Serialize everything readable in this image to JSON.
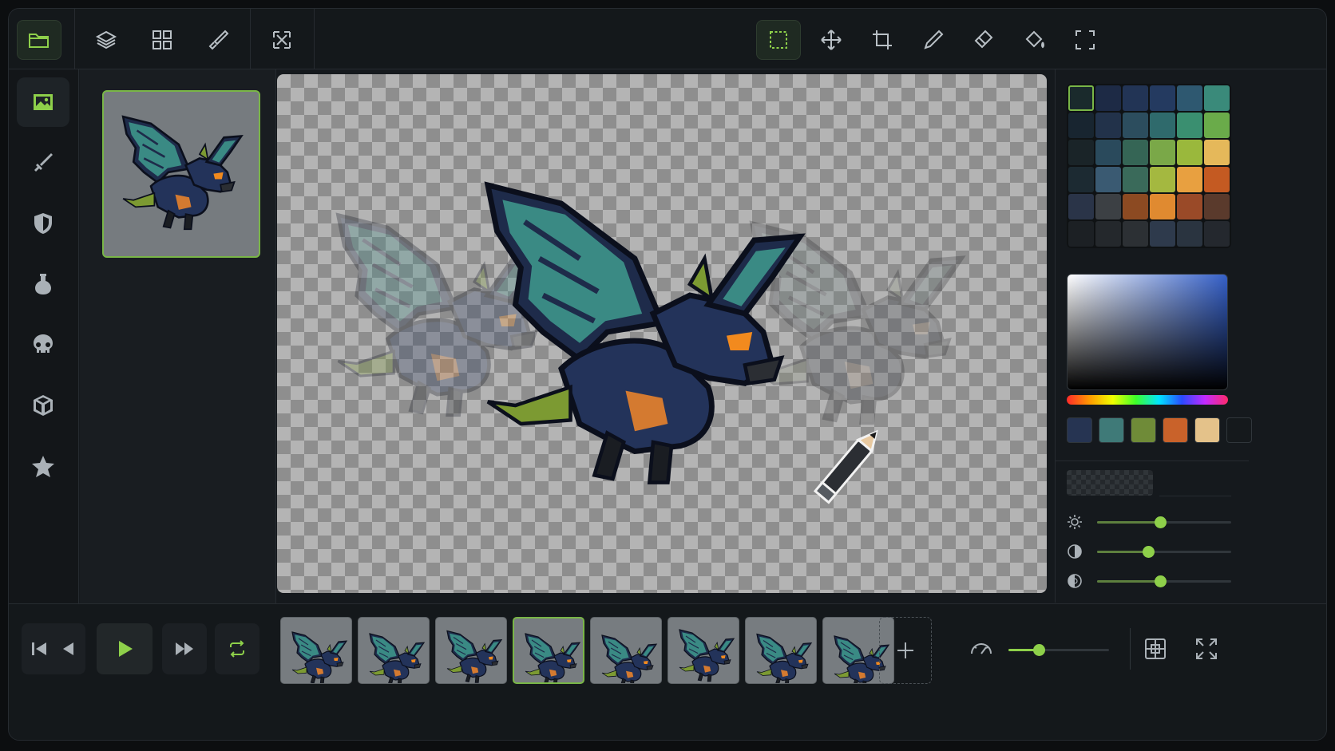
{
  "app": {
    "title": ""
  },
  "toolbar_left": [
    {
      "name": "open-folder-icon",
      "active": true
    },
    {
      "name": "layers-icon",
      "active": false
    },
    {
      "name": "grid-icon",
      "active": false
    },
    {
      "name": "brush-icon",
      "active": false
    },
    {
      "name": "transform-icon",
      "active": false
    }
  ],
  "toolbar_right": [
    {
      "name": "marquee-select-icon",
      "active": true
    },
    {
      "name": "move-icon",
      "active": false
    },
    {
      "name": "crop-icon",
      "active": false
    },
    {
      "name": "pencil-icon",
      "active": false
    },
    {
      "name": "eraser-icon",
      "active": false
    },
    {
      "name": "paint-bucket-icon",
      "active": false
    },
    {
      "name": "select-frame-icon",
      "active": false
    }
  ],
  "sidebar": [
    {
      "name": "image-icon",
      "active": true
    },
    {
      "name": "sword-icon",
      "active": false
    },
    {
      "name": "shield-icon",
      "active": false
    },
    {
      "name": "potion-icon",
      "active": false
    },
    {
      "name": "skull-icon",
      "active": false
    },
    {
      "name": "cube-icon",
      "active": false
    },
    {
      "name": "star-icon",
      "active": false
    }
  ],
  "palette": {
    "selected_index": 0,
    "colors": [
      "#1a2a2c",
      "#1d2a45",
      "#223455",
      "#243a60",
      "#2e5870",
      "#3a8a7a",
      "#182530",
      "#22324a",
      "#2c4d5e",
      "#2f6a6c",
      "#3a8f70",
      "#6aab4a",
      "#1a2428",
      "#2a4a5c",
      "#356555",
      "#7aa848",
      "#9ab83c",
      "#e5b85a",
      "#1c2a32",
      "#3a5a72",
      "#3a6a5a",
      "#a4b840",
      "#e8a040",
      "#c45a22",
      "#2a3448",
      "#3c4044",
      "#8c4a22",
      "#e08a30",
      "#9a4a28",
      "#5a3a2c",
      "#1c2024",
      "#24282c",
      "#2c3034",
      "#2e3a4c",
      "#2a3440",
      "#24282e"
    ],
    "recent_colors": [
      "#263452",
      "#3f7a78",
      "#6f8b38",
      "#c9622a",
      "#e4c28a",
      "#15191c"
    ]
  },
  "adjustments": [
    {
      "name": "brightness",
      "icon": "sun-icon",
      "value": 0.47
    },
    {
      "name": "contrast",
      "icon": "contrast-icon",
      "value": 0.38
    },
    {
      "name": "saturation",
      "icon": "saturation-icon",
      "value": 0.47
    }
  ],
  "timeline": {
    "frame_count": 8,
    "active_frame": 3,
    "fps_level": 0.3
  },
  "colors": {
    "accent": "#8ed04a",
    "panel": "#15191d",
    "border": "#262b30"
  }
}
